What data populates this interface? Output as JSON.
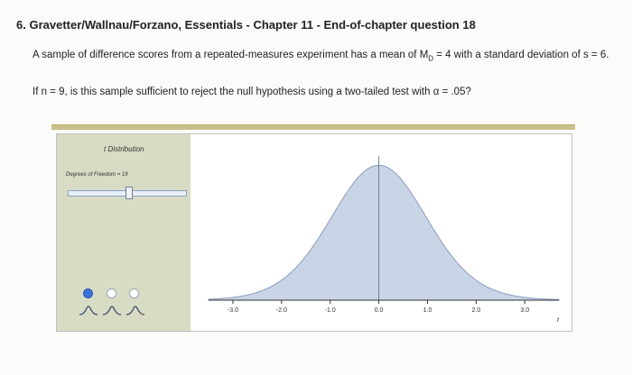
{
  "question": {
    "title": "6. Gravetter/Wallnau/Forzano, Essentials - Chapter 11 - End-of-chapter question 18",
    "line1_prefix": "A sample of difference scores from a repeated-measures experiment has a mean of M",
    "line1_sub": "D",
    "line1_suffix": " = 4 with a standard deviation of s = 6.",
    "line2": "If n = 9, is this sample sufficient to reject the null hypothesis using a two-tailed test with α = .05?"
  },
  "widget": {
    "title": "t Distribution",
    "dof_label": "Degrees of Freedom = 19",
    "slider_value": 19,
    "axis_variable": "t",
    "radios": [
      {
        "name": "radio-one-tail-left",
        "selected": true
      },
      {
        "name": "radio-two-tail",
        "selected": false
      },
      {
        "name": "radio-one-tail-right",
        "selected": false
      }
    ],
    "icons": [
      "left-tail-shape-icon",
      "two-tail-shape-icon",
      "right-tail-shape-icon"
    ],
    "colors": {
      "panel_bg": "#d8dcc4",
      "curve_fill": "#c9d4e6",
      "curve_stroke": "#8a9dbd",
      "radio_on": "#3b6fd9",
      "rule": "#c9c08a"
    }
  },
  "chart_data": {
    "type": "area",
    "title": "",
    "xlabel": "t",
    "ylabel": "",
    "x_ticks": [
      "-3.0",
      "-2.0",
      "-1.0",
      "0.0",
      "1.0",
      "2.0",
      "3.0"
    ],
    "x_tick_values": [
      -3,
      -2,
      -1,
      0,
      1,
      2,
      3
    ],
    "xlim": [
      -3.5,
      3.7
    ],
    "series": [
      {
        "x": [
          -3.5,
          -3.0,
          -2.5,
          -2.0,
          -1.5,
          -1.0,
          -0.5,
          0.0,
          0.5,
          1.0,
          1.5,
          2.0,
          2.5,
          3.0,
          3.5
        ],
        "y": [
          0.002,
          0.006,
          0.019,
          0.058,
          0.128,
          0.236,
          0.347,
          0.394,
          0.347,
          0.236,
          0.128,
          0.058,
          0.019,
          0.006,
          0.002
        ]
      }
    ],
    "vertical_line_at": 0.0
  }
}
